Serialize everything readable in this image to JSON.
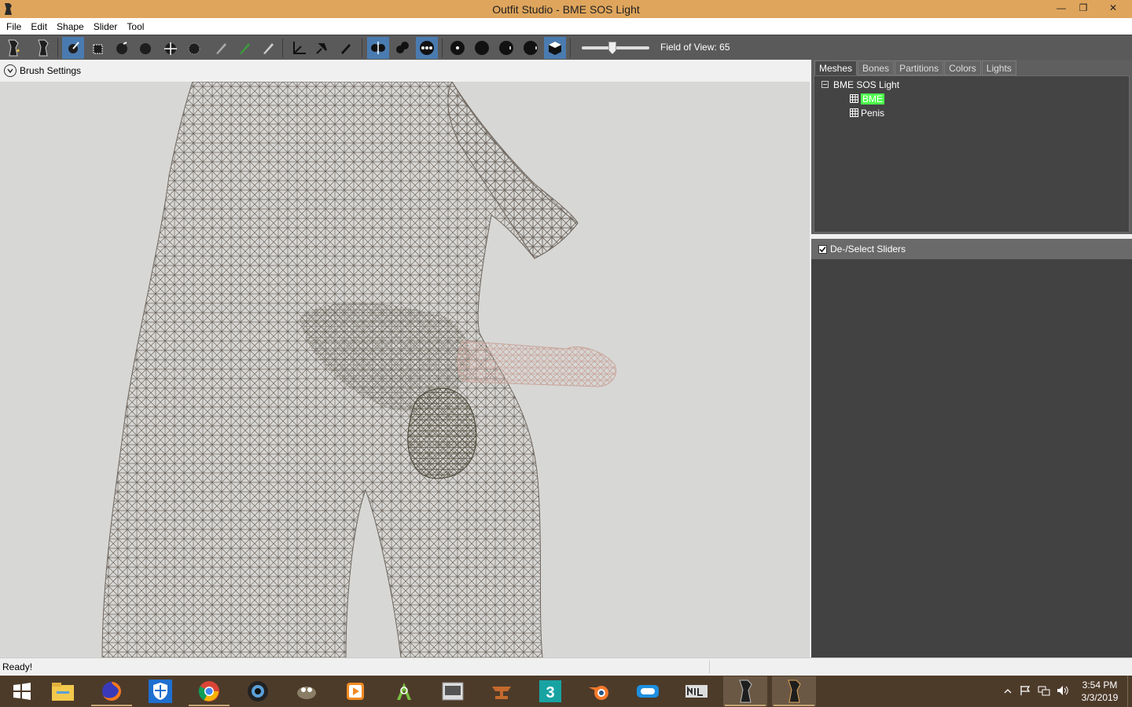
{
  "window": {
    "title": "Outfit Studio - BME SOS Light",
    "minimize_glyph": "—",
    "maximize_glyph": "❐",
    "close_glyph": "✕"
  },
  "menu": [
    "File",
    "Edit",
    "Shape",
    "Slider",
    "Tool"
  ],
  "toolbar": {
    "buttons": [
      "new-project-icon",
      "load-icon",
      "select-icon",
      "mask-icon",
      "inflate-icon",
      "deflate-icon",
      "move-icon",
      "smooth-icon",
      "undiff-icon",
      "weight-icon",
      "color-icon",
      "alpha-icon",
      "transform-icon",
      "pivot-icon",
      "edit-icon",
      "x-mirror-icon",
      "connected-icon",
      "global-brush-icon",
      "light-1-icon",
      "light-2-icon",
      "light-3-icon",
      "light-4-icon",
      "view-cube-icon"
    ],
    "fov_label": "Field of View: 65",
    "fov_value": 65
  },
  "brush": {
    "label": "Brush Settings"
  },
  "tabs": [
    "Meshes",
    "Bones",
    "Partitions",
    "Colors",
    "Lights"
  ],
  "active_tab": "Meshes",
  "tree": {
    "root": "BME SOS Light",
    "children": [
      "BME",
      "Penis"
    ]
  },
  "sliders": {
    "label": "De-/Select Sliders"
  },
  "status": {
    "text": "Ready!"
  },
  "taskbar": {
    "apps": [
      "windows-start-icon",
      "file-explorer-icon",
      "firefox-icon",
      "defender-icon",
      "chrome-icon",
      "webcam-icon",
      "gimp-icon",
      "media-player-icon",
      "android-studio-icon",
      "launcher-icon",
      "anvil-icon",
      "3ds-max-icon",
      "blender-icon",
      "app-icon",
      "nif-icon",
      "outfit-studio-icon",
      "outfit-studio-2-icon"
    ],
    "clock_time": "3:54 PM",
    "clock_date": "3/3/2019"
  },
  "colors": {
    "titlebar": "#dfa55c",
    "toolbar": "#5a5a5a",
    "viewport": "#d7d7d5",
    "highlight": "#4cff4c",
    "taskbar": "#4d3b2a"
  }
}
